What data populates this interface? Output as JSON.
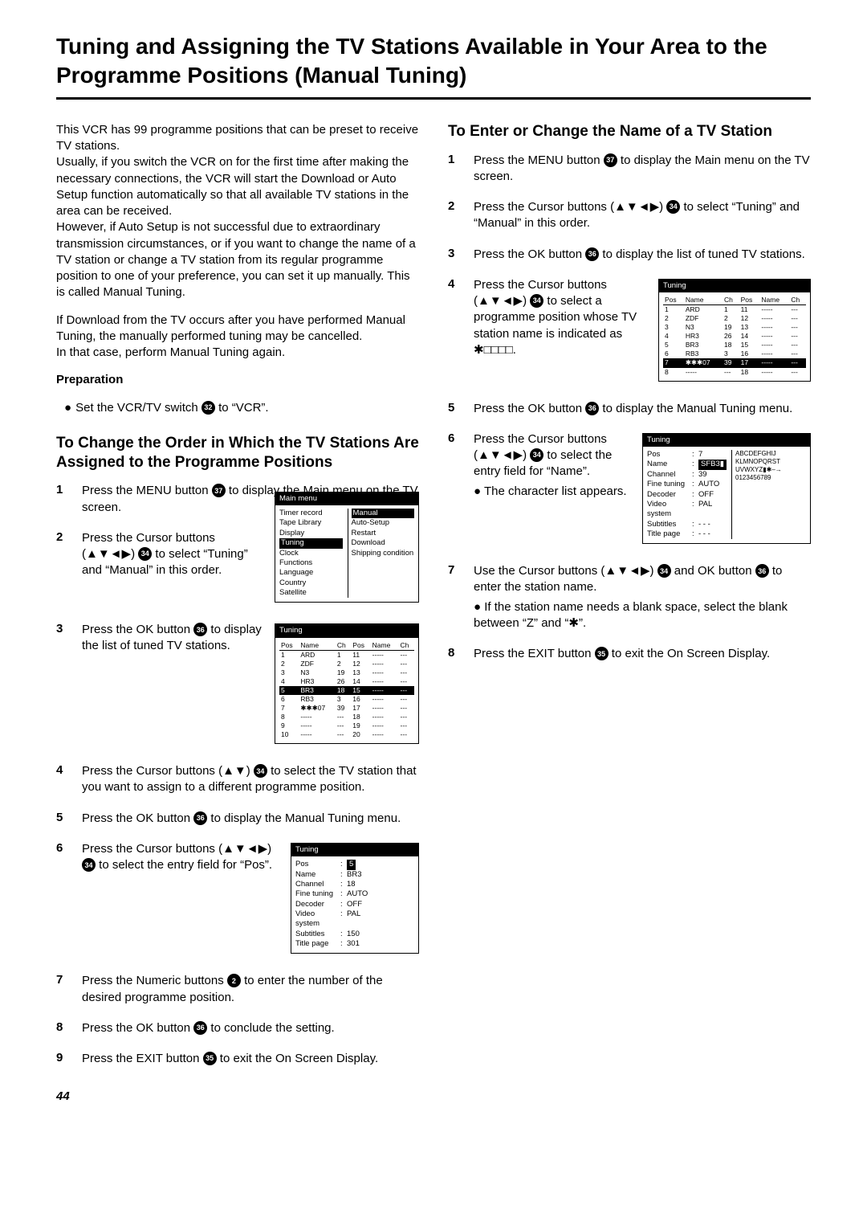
{
  "page_title": "Tuning and Assigning the TV Stations Available in Your Area to the Programme Positions (Manual Tuning)",
  "page_number": "44",
  "intro": {
    "p1": "This VCR has 99 programme positions that can be preset to receive TV stations.",
    "p2": "Usually, if you switch the VCR on for the first time after making the necessary connections, the VCR will start the Download or Auto Setup function automatically so that all available TV stations in the area can be received.",
    "p3": "However, if Auto Setup is not successful due to extraordinary transmission circumstances, or if you want to change the name of a TV station or change a TV station from its regular programme position to one of your preference, you can set it up manually. This is called Manual Tuning.",
    "p4": "If Download from the TV occurs after you have performed Manual Tuning, the manually performed tuning may be cancelled.",
    "p5": "In that case, perform Manual Tuning again.",
    "prep_head": "Preparation",
    "prep_item": "Set the VCR/TV switch",
    "prep_item_tail": " to “VCR”."
  },
  "section_a": {
    "title": "To Change the Order in Which the TV Stations Are Assigned to the Programme Positions",
    "s1a": "Press the MENU button ",
    "s1b": " to display the Main menu on the TV screen.",
    "s2a": "Press the Cursor buttons (▲▼◄▶) ",
    "s2b": " to select “Tuning” and “Manual” in this order.",
    "s3a": "Press the OK button ",
    "s3b": " to display the list of tuned TV stations.",
    "s4a": "Press the Cursor buttons (▲▼) ",
    "s4b": " to select the TV station that you want to assign to a different programme position.",
    "s5a": "Press the OK button ",
    "s5b": " to display the Manual Tuning menu.",
    "s6a": "Press the Cursor buttons (▲▼◄▶) ",
    "s6b": " to select the entry field for “Pos”.",
    "s7a": "Press the Numeric buttons ",
    "s7b": " to enter the number of the desired programme position.",
    "s8a": "Press the OK button ",
    "s8b": " to conclude the setting.",
    "s9a": "Press the EXIT button ",
    "s9b": " to exit the On Screen Display."
  },
  "section_b": {
    "title": "To Enter or Change the Name of a TV Station",
    "s1a": "Press the MENU button ",
    "s1b": " to display the Main menu on the TV screen.",
    "s2a": "Press the Cursor buttons (▲▼◄▶) ",
    "s2b": " to select “Tuning” and “Manual” in this order.",
    "s3a": "Press the OK button ",
    "s3b": " to display the list of tuned TV stations.",
    "s4a": "Press the Cursor buttons (▲▼◄▶) ",
    "s4b": " to select a programme position whose TV station name is indicated as ✱□□□□.",
    "s5a": "Press the OK button ",
    "s5b": " to display the Manual Tuning menu.",
    "s6a": "Press the Cursor buttons (▲▼◄▶) ",
    "s6b": " to select the entry field for “Name”.",
    "s6c": "The character list appears.",
    "s7a": "Use the Cursor buttons (▲▼◄▶) ",
    "s7b": " and OK button ",
    "s7c": " to enter the station name.",
    "s7d": "If the station name needs a blank space, select the blank between “Z” and “✱”.",
    "s8a": "Press the EXIT button ",
    "s8b": " to exit the On Screen Display."
  },
  "refs": {
    "r2": "2",
    "r32": "32",
    "r34": "34",
    "r35": "35",
    "r36": "36",
    "r37": "37"
  },
  "osd": {
    "mainmenu": {
      "title": "Main menu",
      "left": [
        "Timer record",
        "Tape Library",
        "Display",
        "Tuning",
        "Clock",
        "Functions",
        "Language",
        "Country",
        "Satellite"
      ],
      "right": [
        "Manual",
        "Auto-Setup Restart",
        "Download",
        "Shipping condition"
      ]
    },
    "list1": {
      "title": "Tuning",
      "headers": [
        "Pos",
        "Name",
        "Ch",
        "Pos",
        "Name",
        "Ch"
      ],
      "rows": [
        [
          "1",
          "ARD",
          "1",
          "11",
          "-----",
          "---"
        ],
        [
          "2",
          "ZDF",
          "2",
          "12",
          "-----",
          "---"
        ],
        [
          "3",
          "N3",
          "19",
          "13",
          "-----",
          "---"
        ],
        [
          "4",
          "HR3",
          "26",
          "14",
          "-----",
          "---"
        ],
        [
          "5",
          "BR3",
          "18",
          "15",
          "-----",
          "---"
        ],
        [
          "6",
          "RB3",
          "3",
          "16",
          "-----",
          "---"
        ],
        [
          "7",
          "✱✱✱07",
          "39",
          "17",
          "-----",
          "---"
        ],
        [
          "8",
          "-----",
          "---",
          "18",
          "-----",
          "---"
        ],
        [
          "9",
          "-----",
          "---",
          "19",
          "-----",
          "---"
        ],
        [
          "10",
          "-----",
          "---",
          "20",
          "-----",
          "---"
        ]
      ],
      "selected_row": 4
    },
    "detail": {
      "title": "Tuning",
      "rows": [
        [
          "Pos",
          "5"
        ],
        [
          "Name",
          "BR3"
        ],
        [
          "Channel",
          "18"
        ],
        [
          "Fine tuning",
          "AUTO"
        ],
        [
          "Decoder",
          "OFF"
        ],
        [
          "Video system",
          "PAL"
        ],
        [
          "Subtitles",
          "150"
        ],
        [
          "Title page",
          "301"
        ]
      ],
      "highlight": 0
    },
    "list2": {
      "title": "Tuning",
      "headers": [
        "Pos",
        "Name",
        "Ch",
        "Pos",
        "Name",
        "Ch"
      ],
      "rows": [
        [
          "1",
          "ARD",
          "1",
          "11",
          "-----",
          "---"
        ],
        [
          "2",
          "ZDF",
          "2",
          "12",
          "-----",
          "---"
        ],
        [
          "3",
          "N3",
          "19",
          "13",
          "-----",
          "---"
        ],
        [
          "4",
          "HR3",
          "26",
          "14",
          "-----",
          "---"
        ],
        [
          "5",
          "BR3",
          "18",
          "15",
          "-----",
          "---"
        ],
        [
          "6",
          "RB3",
          "3",
          "16",
          "-----",
          "---"
        ],
        [
          "7",
          "✱✱✱07",
          "39",
          "17",
          "-----",
          "---"
        ],
        [
          "8",
          "-----",
          "---",
          "18",
          "-----",
          "---"
        ]
      ],
      "selected_row": 6
    },
    "detail2": {
      "title": "Tuning",
      "rows": [
        [
          "Pos",
          "7"
        ],
        [
          "Name",
          "SFB3▮"
        ],
        [
          "Channel",
          "39"
        ],
        [
          "Fine tuning",
          "AUTO"
        ],
        [
          "Decoder",
          "OFF"
        ],
        [
          "Video system",
          "PAL"
        ],
        [
          "Subtitles",
          "- - -"
        ],
        [
          "Title page",
          "- - -"
        ]
      ],
      "highlight": 1,
      "charlist1": "ABCDEFGHIJ",
      "charlist2": "KLMNOPQRST",
      "charlist3": "UVWXYZ▮✱–→",
      "charlist4": "0123456789"
    }
  }
}
